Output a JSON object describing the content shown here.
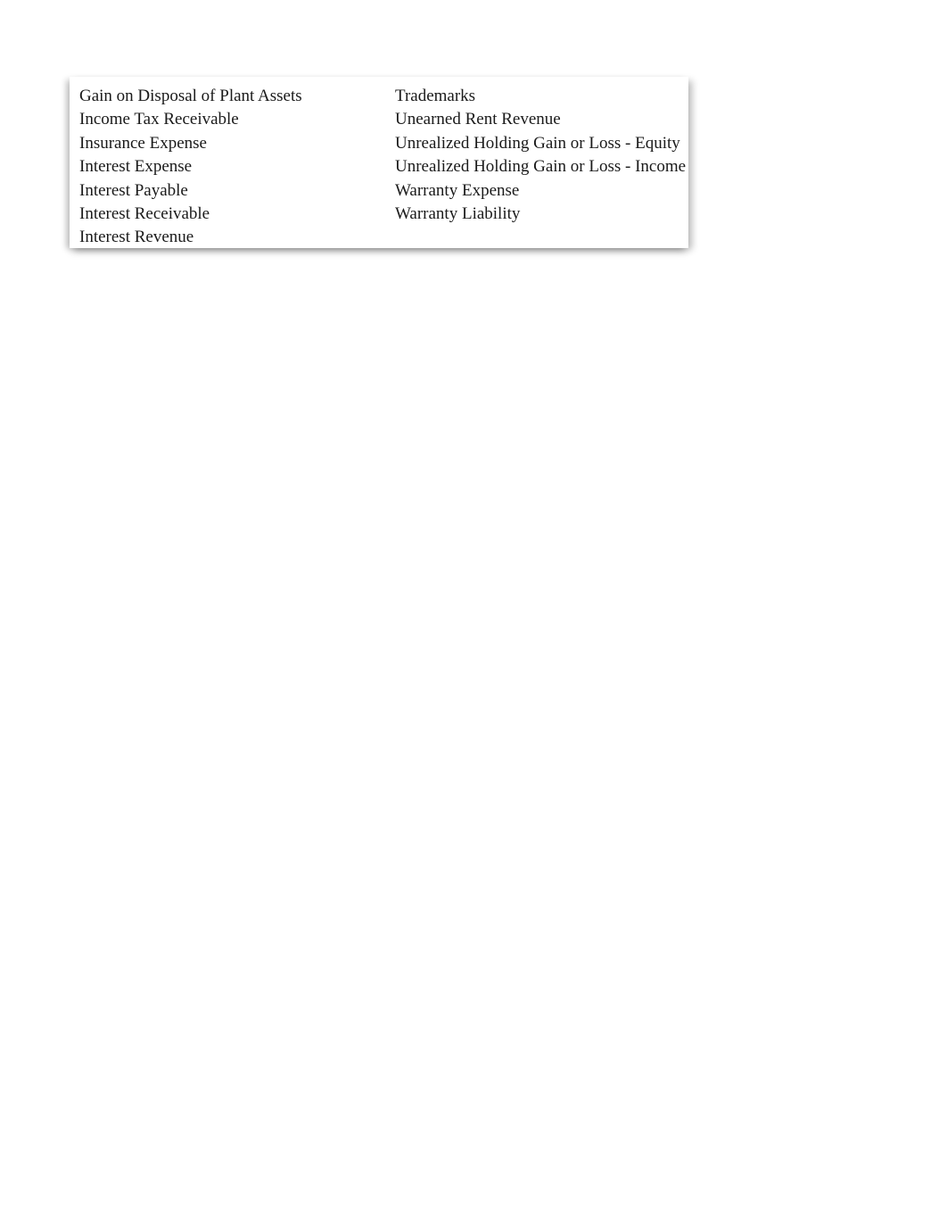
{
  "panel": {
    "name": "account-titles-list",
    "columns": [
      {
        "name": "left-column",
        "items": [
          "Gain on Disposal of Plant Assets",
          "Income Tax Receivable",
          "Insurance Expense",
          "Interest Expense",
          "Interest Payable",
          "Interest Receivable",
          "Interest Revenue"
        ]
      },
      {
        "name": "right-column",
        "items": [
          "Trademarks",
          "Unearned Rent Revenue",
          "Unrealized Holding Gain or Loss - Equity",
          "Unrealized Holding Gain or Loss - Income",
          "Warranty Expense",
          "Warranty Liability"
        ]
      }
    ]
  },
  "colors": {
    "text": "#1a1a1a",
    "background": "#ffffff",
    "shadow": "#d5d5d5"
  }
}
